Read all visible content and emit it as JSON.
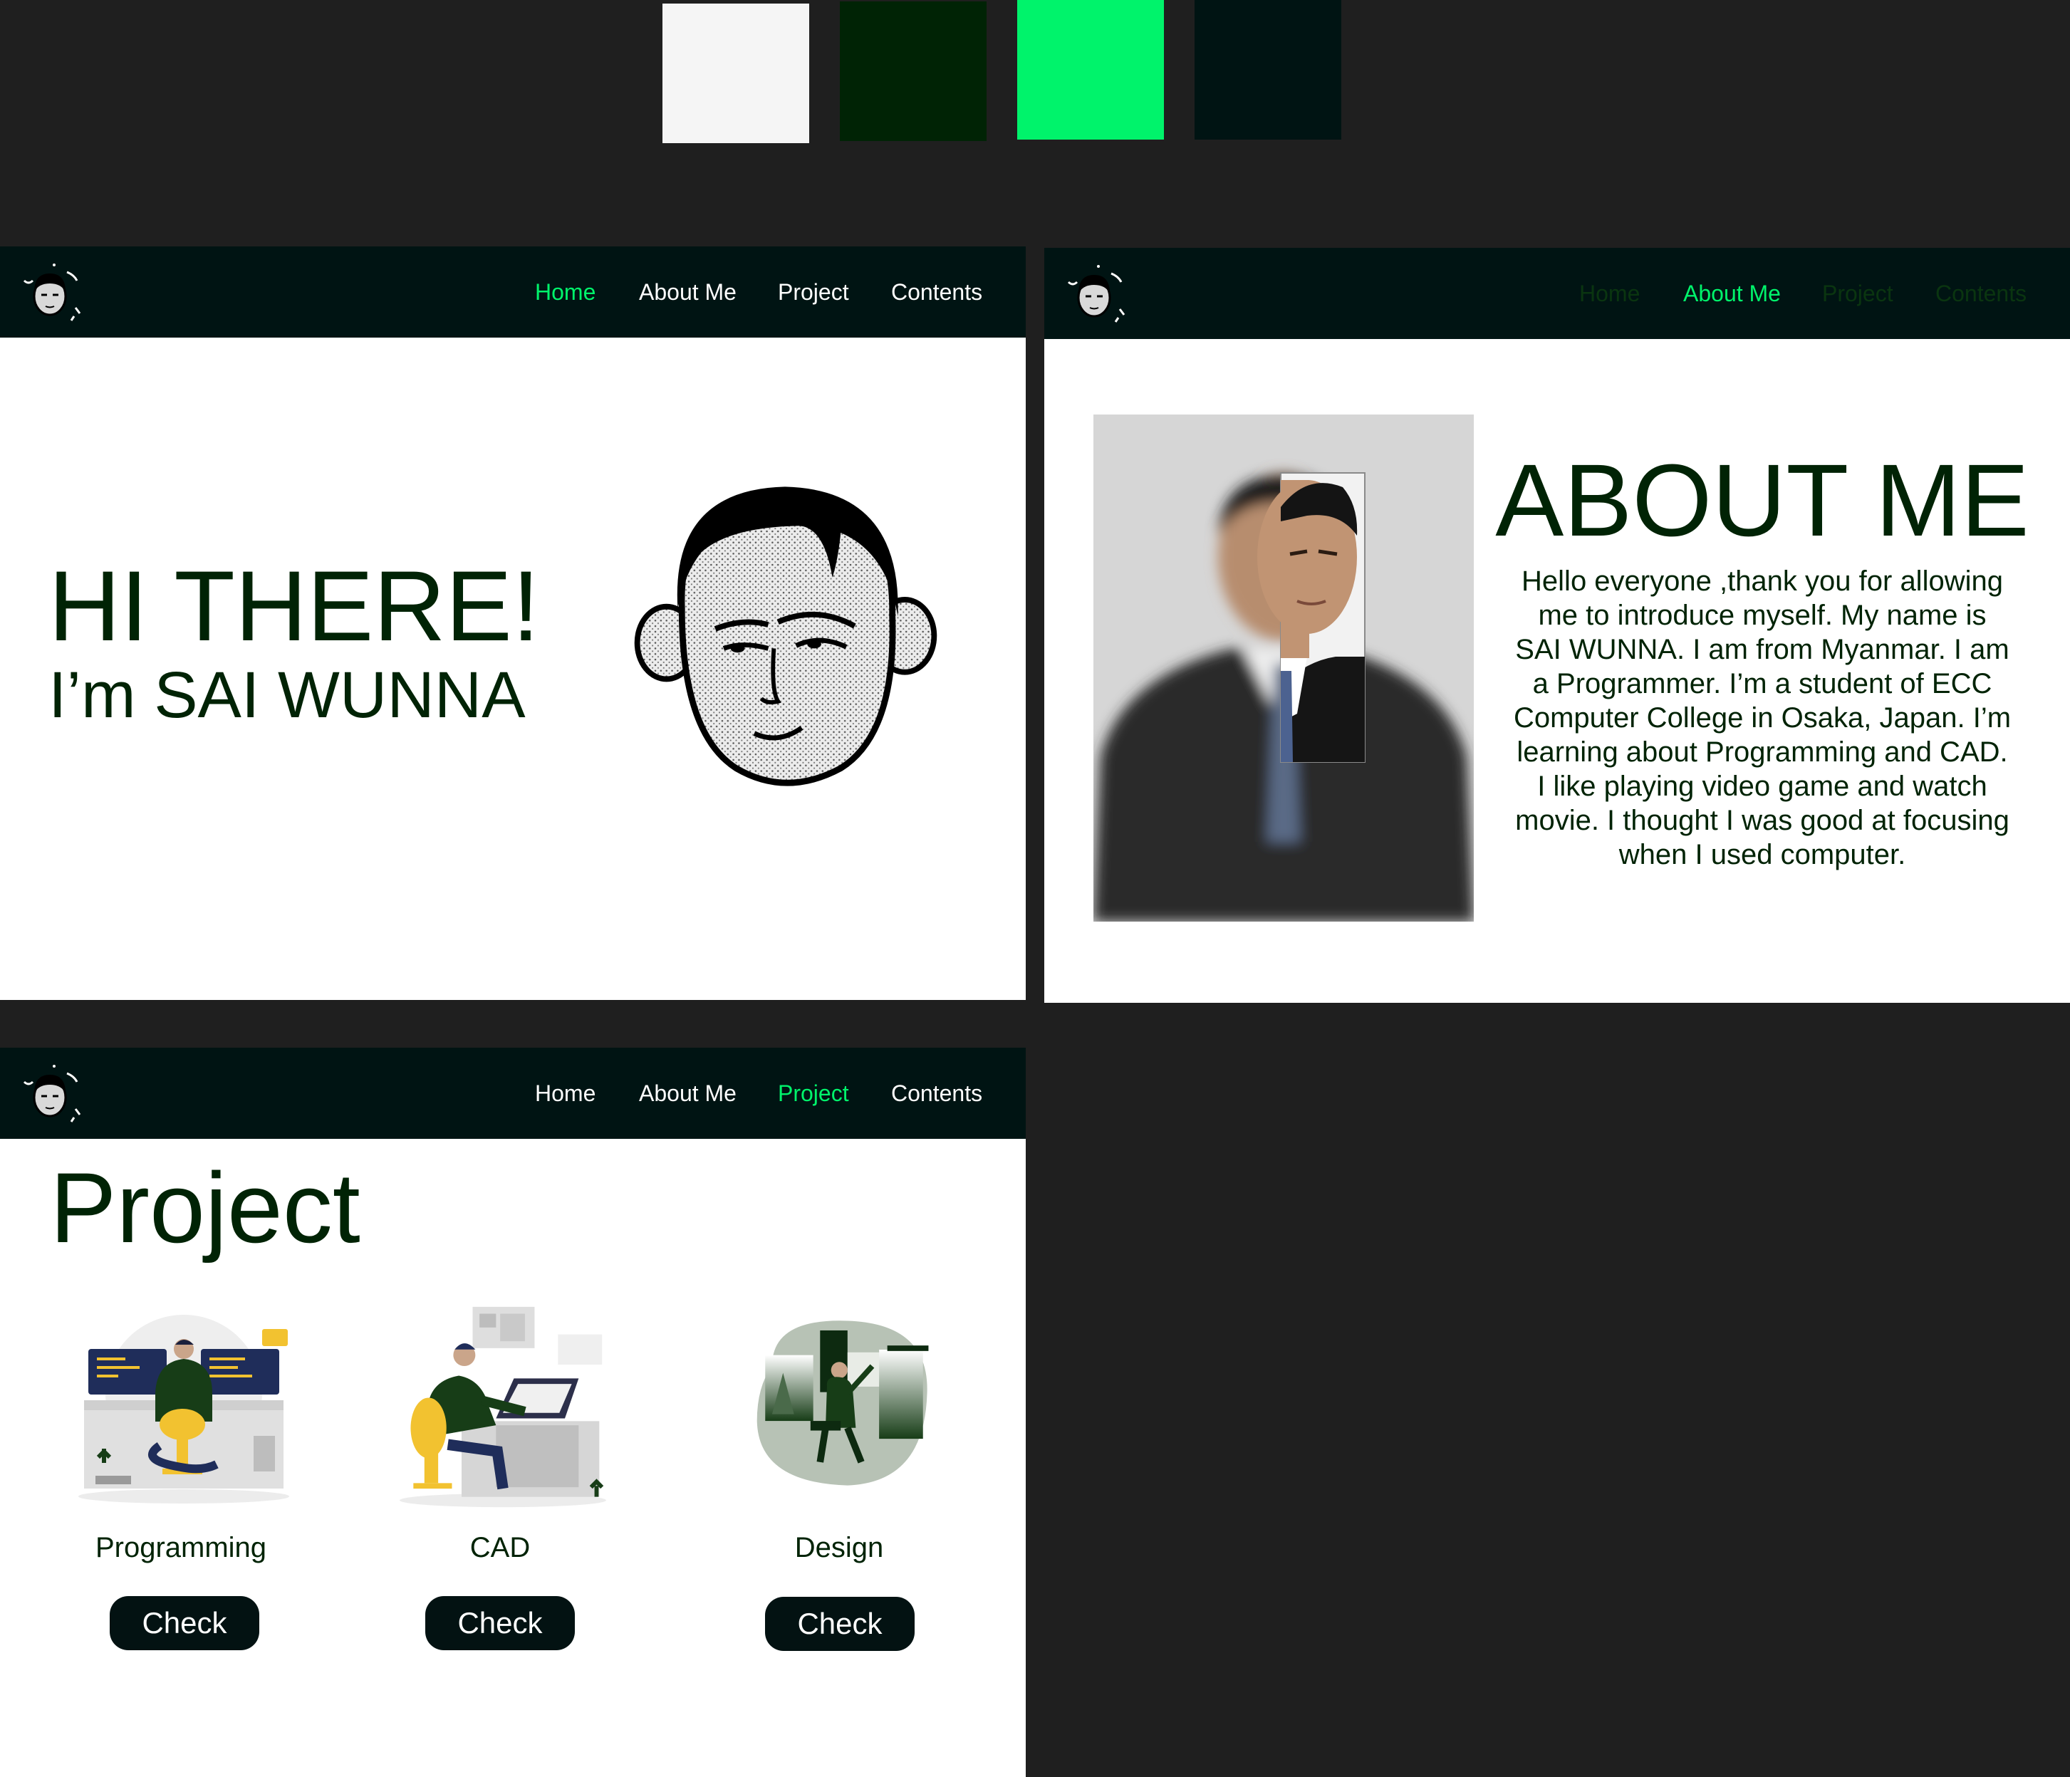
{
  "palette": [
    "#f5f5f5",
    "#002305",
    "#00f36b",
    "#001413"
  ],
  "colors": {
    "nav_bg": "#001413",
    "accent": "#00f36b",
    "dark_green": "#002305",
    "canvas_bg": "#1f1f1f",
    "button_bg": "#031212"
  },
  "nav": {
    "home": "Home",
    "about": "About Me",
    "project": "Project",
    "contents": "Contents"
  },
  "home": {
    "heading": "HI THERE!",
    "subheading": "I’m SAI WUNNA",
    "illustration": "avatar-face-icon"
  },
  "about": {
    "title": "ABOUT ME",
    "bio_lines": [
      "Hello everyone ,thank you for allowing",
      "me to introduce myself. My name is",
      "SAI WUNNA. I am from Myanmar. I am",
      "a Programmer. I’m a student of ECC",
      "Computer College in Osaka, Japan. I’m",
      "learning about Programming and CAD.",
      "I like playing video game and watch",
      "movie. I thought I was good at focusing",
      "when I used computer."
    ]
  },
  "project": {
    "title": "Project",
    "cards": [
      {
        "label": "Programming",
        "button": "Check",
        "icon": "programmer-at-desk-illustration"
      },
      {
        "label": "CAD",
        "button": "Check",
        "icon": "cad-designer-illustration"
      },
      {
        "label": "Design",
        "button": "Check",
        "icon": "designer-drawing-illustration"
      }
    ]
  }
}
